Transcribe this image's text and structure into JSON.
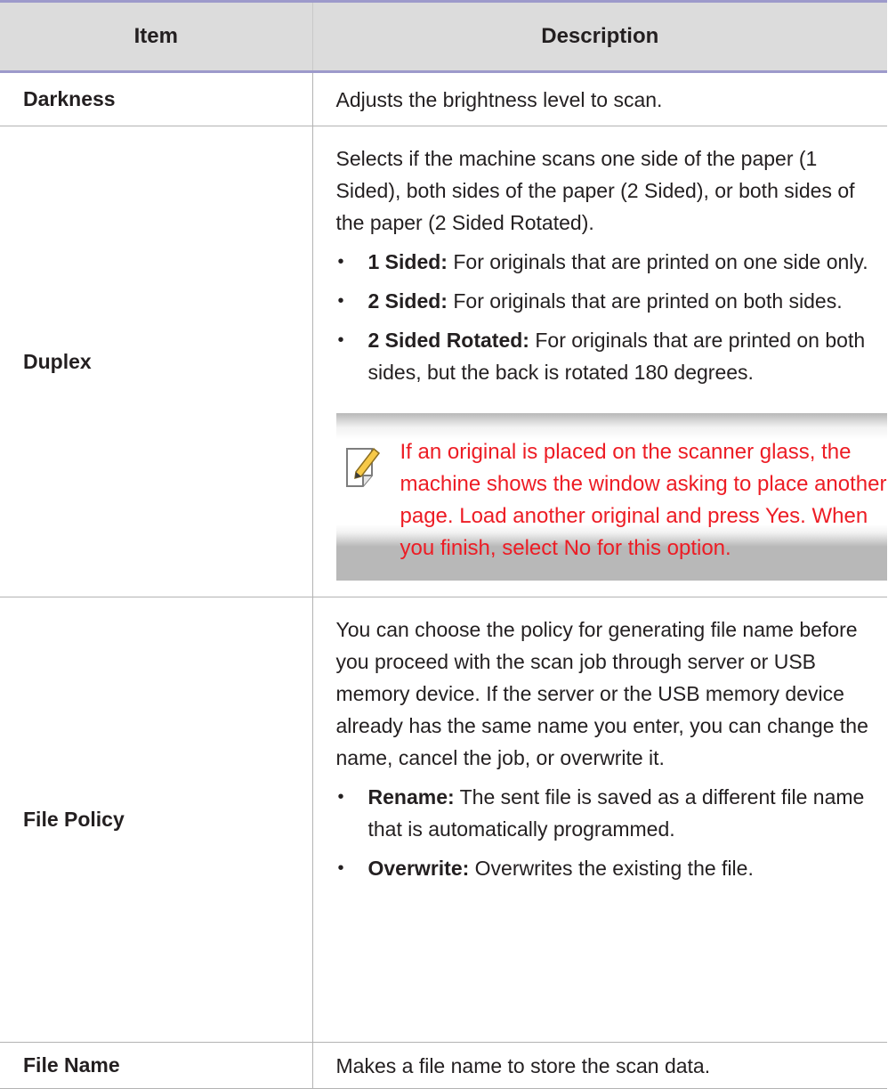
{
  "table": {
    "headers": {
      "item": "Item",
      "description": "Description"
    },
    "rows": {
      "darkness": {
        "item": "Darkness",
        "description": "Adjusts the brightness level to scan."
      },
      "duplex": {
        "item": "Duplex",
        "intro": "Selects if the machine scans one side of the paper (1 Sided), both sides of the paper (2 Sided), or both sides of the paper (2 Sided Rotated).",
        "options": [
          {
            "term": "1 Sided:",
            "text": " For originals that are printed on one side only."
          },
          {
            "term": "2 Sided:",
            "text": " For originals that are printed on both sides."
          },
          {
            "term": "2 Sided Rotated:",
            "text": " For originals that are printed on both sides, but the back is rotated 180 degrees."
          }
        ],
        "note": "If an original is placed on the scanner glass, the machine shows the window asking to place another page. Load another original and press Yes. When you finish, select No for this option."
      },
      "file_policy": {
        "item": "File Policy",
        "intro": "You can choose the policy for generating file name before you proceed with the scan job through server or USB memory device. If the server or the USB memory device already has the same name you enter, you can change the name, cancel the job, or overwrite it.",
        "options": [
          {
            "term": "Rename:",
            "text": " The sent file is saved as a different file name that is automatically programmed."
          },
          {
            "term": "Overwrite:",
            "text": " Overwrites the existing the file."
          }
        ]
      },
      "file_name": {
        "item": "File Name",
        "description": "Makes a file name to store the scan data."
      }
    }
  },
  "style": {
    "header_bg": "#dcdcdc",
    "rule_color": "#9d9acb",
    "note_color": "#ed1c24"
  },
  "icons": {
    "note": "note-pencil-icon",
    "bullet": "bullet"
  }
}
